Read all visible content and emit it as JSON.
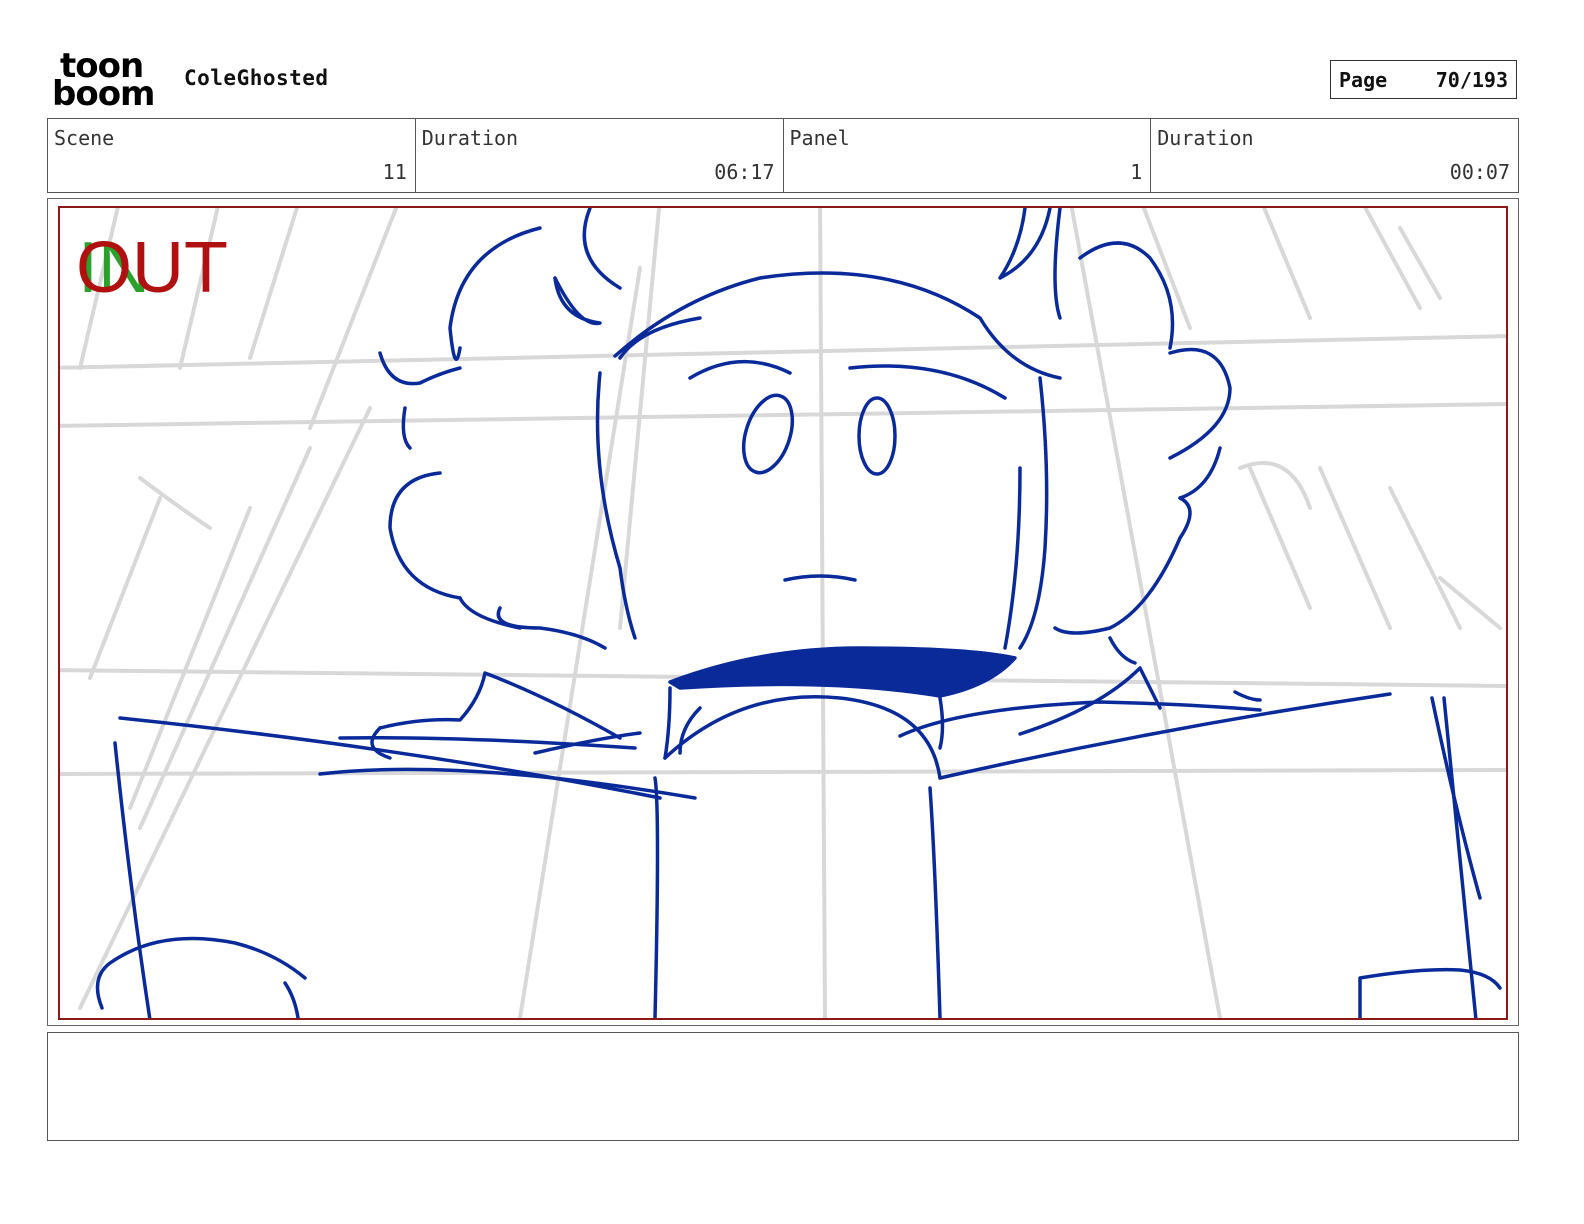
{
  "header": {
    "logo_top": "toon",
    "logo_bottom": "boom",
    "project_title": "ColeGhosted",
    "page_label": "Page",
    "page_value": "70/193"
  },
  "info": {
    "scene_label": "Scene",
    "scene_value": "11",
    "scene_duration_label": "Duration",
    "scene_duration_value": "06:17",
    "panel_label": "Panel",
    "panel_value": "1",
    "panel_duration_label": "Duration",
    "panel_duration_value": "00:07"
  },
  "panel": {
    "in_mark": "IN",
    "out_mark": "OUT",
    "frame_color": "#8b1a1a",
    "sketch_color": "#0a2a9a",
    "background_sketch_color": "#d8d8d8",
    "in_color": "#2ca02c",
    "out_color": "#b01010"
  },
  "notes": {
    "text": ""
  }
}
